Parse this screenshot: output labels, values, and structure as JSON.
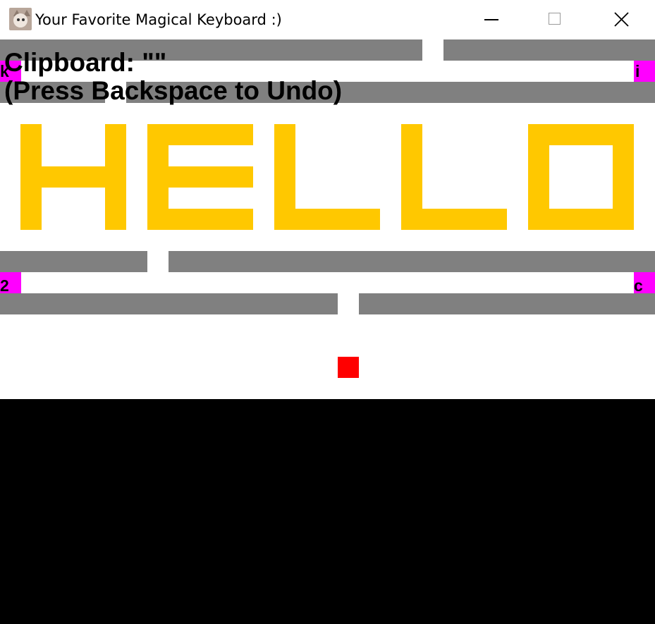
{
  "window": {
    "title": "Your Favorite Magical Keyboard :)",
    "icon": "cat-photo-icon",
    "controls": [
      "minimize-icon",
      "maximize-icon",
      "close-icon"
    ]
  },
  "hud": {
    "clipboard_line": "Clipboard: \"\"",
    "undo_hint": "(Press Backspace to Undo)"
  },
  "portals": {
    "top_left": "k",
    "top_right": "i",
    "bottom_left": "2",
    "bottom_right": "c"
  },
  "banner_word": "HELLO",
  "colors": {
    "wall": "#808080",
    "portal": "#ff00ff",
    "banner": "#ffc800",
    "player": "#ff0000",
    "background": "#ffffff",
    "outside": "#000000"
  }
}
